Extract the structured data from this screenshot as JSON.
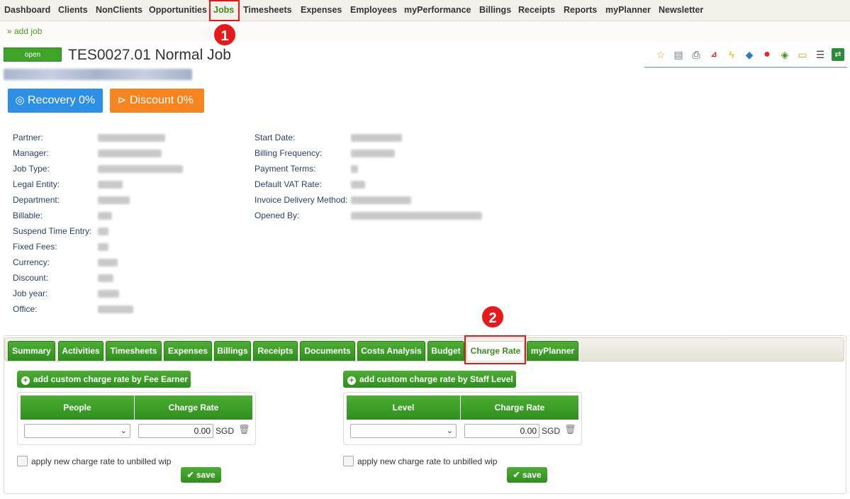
{
  "nav": {
    "items": [
      "Dashboard",
      "Clients",
      "NonClients",
      "Opportunities",
      "Jobs",
      "Timesheets",
      "Expenses",
      "Employees",
      "myPerformance",
      "Billings",
      "Receipts",
      "Reports",
      "myPlanner",
      "Newsletter"
    ],
    "active": "Jobs"
  },
  "subnav": {
    "add_job": "» add job"
  },
  "annotations": {
    "marker1": "1",
    "marker2": "2",
    "marker_color": "#e8191b"
  },
  "job": {
    "status": "open",
    "title": "TES0027.01 Normal Job"
  },
  "toolbar": {
    "icons": [
      "star-icon",
      "calendar-icon",
      "print-icon",
      "pdf-icon",
      "flash-icon",
      "report-icon",
      "record-icon",
      "money-icon",
      "note-icon",
      "list-icon",
      "excel-icon"
    ]
  },
  "summary_buttons": {
    "recovery": "Recovery 0%",
    "discount": "Discount 0%"
  },
  "details_left": {
    "labels": [
      "Partner:",
      "Manager:",
      "Job Type:",
      "Legal Entity:",
      "Department:",
      "Billable:",
      "Suspend Time Entry:",
      "Fixed Fees:",
      "Currency:",
      "Discount:",
      "Job year:",
      "Office:"
    ]
  },
  "details_right": {
    "labels": [
      "Start Date:",
      "Billing Frequency:",
      "Payment Terms:",
      "Default VAT Rate:",
      "Invoice Delivery Method:",
      "Opened By:"
    ]
  },
  "tabs": {
    "items": [
      "Summary",
      "Activities",
      "Timesheets",
      "Expenses",
      "Billings",
      "Receipts",
      "Documents",
      "Costs Analysis",
      "Budget",
      "Charge Rate",
      "myPlanner"
    ],
    "active": "Charge Rate"
  },
  "fee_earner": {
    "add_button": "add custom charge rate by Fee Earner",
    "col_people": "People",
    "col_rate": "Charge Rate",
    "select_value": "",
    "rate_value": "0.00",
    "currency": "SGD",
    "apply_label": "apply new charge rate to unbilled wip",
    "save_label": "save"
  },
  "staff_level": {
    "add_button": "add custom charge rate by Staff Level",
    "col_level": "Level",
    "col_rate": "Charge Rate",
    "select_value": "",
    "rate_value": "0.00",
    "currency": "SGD",
    "apply_label": "apply new charge rate to unbilled wip",
    "save_label": "save"
  },
  "colors": {
    "accent_green": "#3c8e1a",
    "recovery_blue": "#2e8fe6",
    "discount_orange": "#f7851f",
    "highlight_red": "#e01a1a"
  }
}
